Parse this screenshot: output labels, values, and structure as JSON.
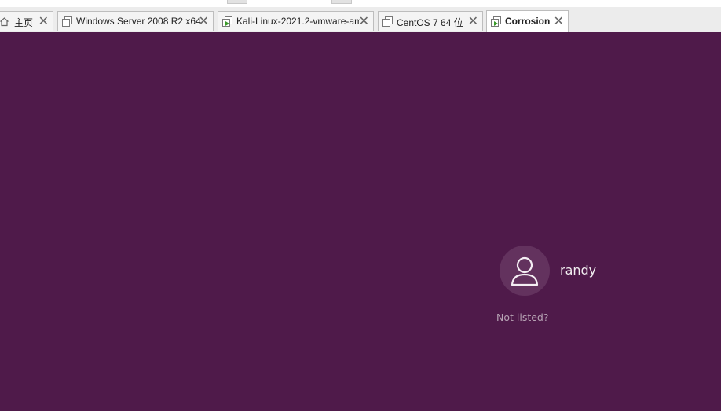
{
  "tabs": [
    {
      "label": "主页",
      "icon": "home-icon",
      "active": false
    },
    {
      "label": "Windows Server 2008 R2 x64",
      "icon": "vm-icon",
      "active": false
    },
    {
      "label": "Kali-Linux-2021.2-vmware-am…",
      "icon": "vm-running-icon",
      "active": false
    },
    {
      "label": "CentOS 7 64 位",
      "icon": "vm-icon",
      "active": false
    },
    {
      "label": "Corrosion",
      "icon": "vm-running-icon",
      "active": true
    }
  ],
  "login": {
    "username": "randy",
    "avatar_icon": "user-avatar-icon",
    "not_listed": "Not listed?"
  },
  "colors": {
    "background": "#4f1a4a",
    "avatar_bg": "#63325e",
    "running_green": "#3a9a2a"
  }
}
